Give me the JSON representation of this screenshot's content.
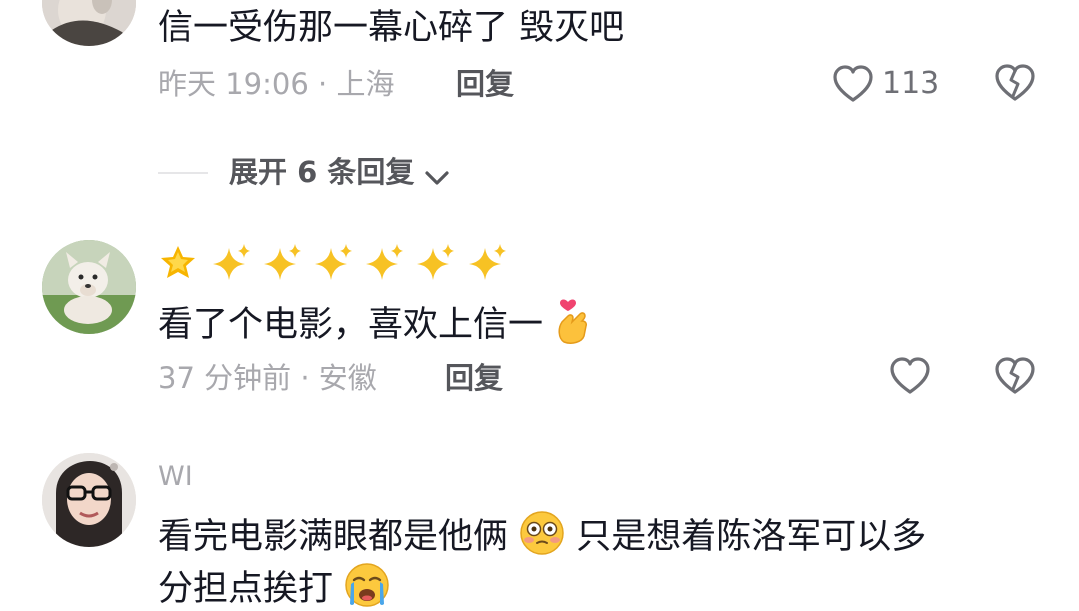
{
  "comments": [
    {
      "text": "信一受伤那一幕心碎了 毁灭吧",
      "meta": "昨天 19:06 · 上海",
      "reply_label": "回复",
      "likes": "113",
      "expand_label": "展开 6 条回复"
    },
    {
      "text_part1": "看了个电影，喜欢上信一",
      "meta": "37 分钟前 · 安徽",
      "reply_label": "回复"
    },
    {
      "username": "WI",
      "text_line1_a": "看完电影满眼都是他俩",
      "text_line1_b": "只是想着陈洛军可以多",
      "text_line2": "分担点挨打"
    }
  ],
  "colors": {
    "text": "#161823",
    "meta": "#a8a8ad",
    "reply": "#55565b",
    "heart": "#6e6f75"
  }
}
